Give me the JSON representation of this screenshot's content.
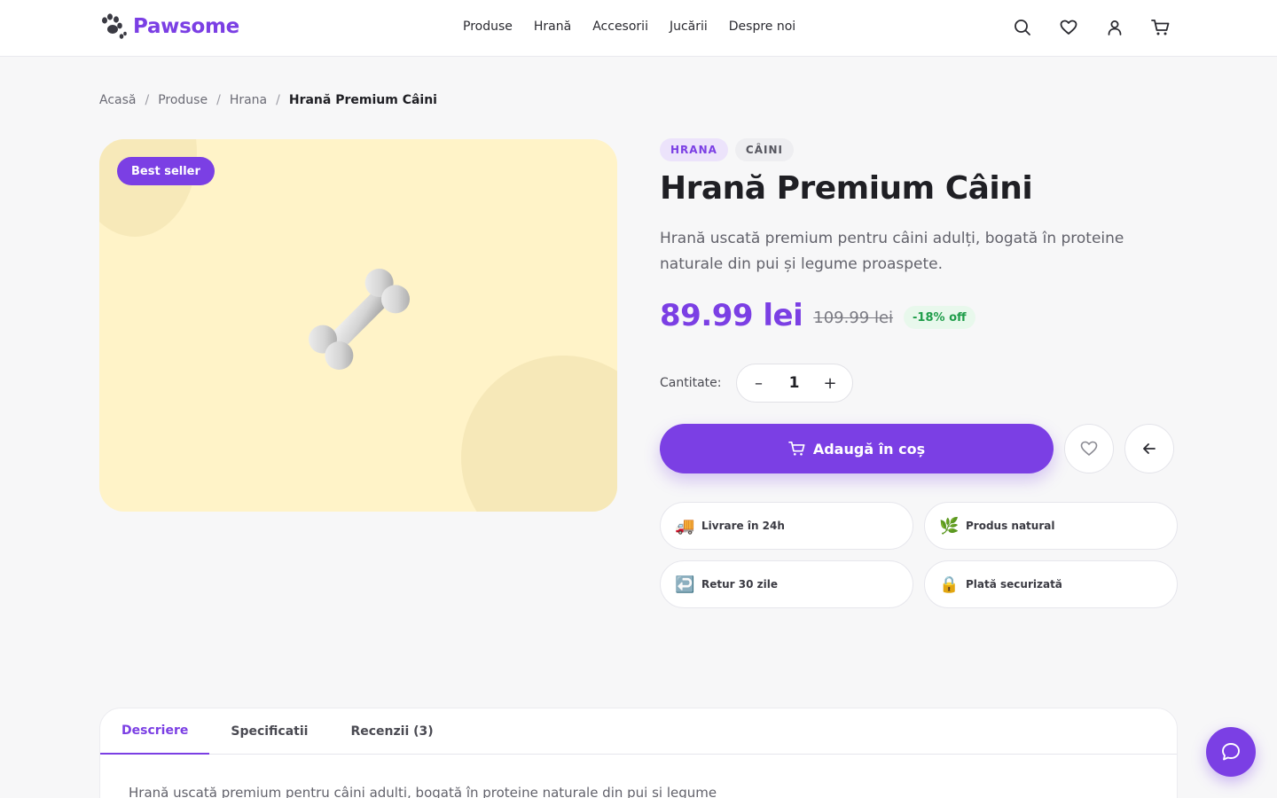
{
  "brand": {
    "name": "Pawsome",
    "icon": "paw-icon"
  },
  "nav": {
    "items": [
      "Produse",
      "Hrană",
      "Accesorii",
      "Jucării",
      "Despre noi"
    ]
  },
  "header_icons": [
    "search-icon",
    "heart-icon",
    "user-icon",
    "cart-icon"
  ],
  "breadcrumb": {
    "items": [
      "Acasă",
      "Produse",
      "Hrana"
    ],
    "current": "Hrană Premium Câini",
    "separator": "/"
  },
  "product": {
    "badge": "Best seller",
    "image_icon": "bone-icon",
    "tags": [
      "HRANA",
      "CÂINI"
    ],
    "title": "Hrană Premium Câini",
    "description": "Hrană uscată premium pentru câini adulți, bogată în proteine naturale din pui și legume proaspete.",
    "price": "89.99 lei",
    "old_price": "109.99 lei",
    "discount": "-18% off",
    "quantity_label": "Cantitate:",
    "quantity": "1",
    "decrement": "–",
    "increment": "+",
    "add_to_cart": "Adaugă în coș"
  },
  "features": [
    {
      "icon": "🚚",
      "label": "Livrare în 24h"
    },
    {
      "icon": "🌿",
      "label": "Produs natural"
    },
    {
      "icon": "↩️",
      "label": "Retur 30 zile"
    },
    {
      "icon": "🔒",
      "label": "Plată securizată"
    }
  ],
  "tabs": {
    "items": [
      "Descriere",
      "Specificatii",
      "Recenzii (3)"
    ],
    "active": "Descriere",
    "content": "Hrană uscată premium pentru câini adulți, bogată în proteine naturale din pui și legume"
  },
  "colors": {
    "accent": "#7b3fe4",
    "image_bg": "#fff3c8",
    "discount_bg": "#e8f8ec",
    "discount_text": "#1f9d4a"
  }
}
